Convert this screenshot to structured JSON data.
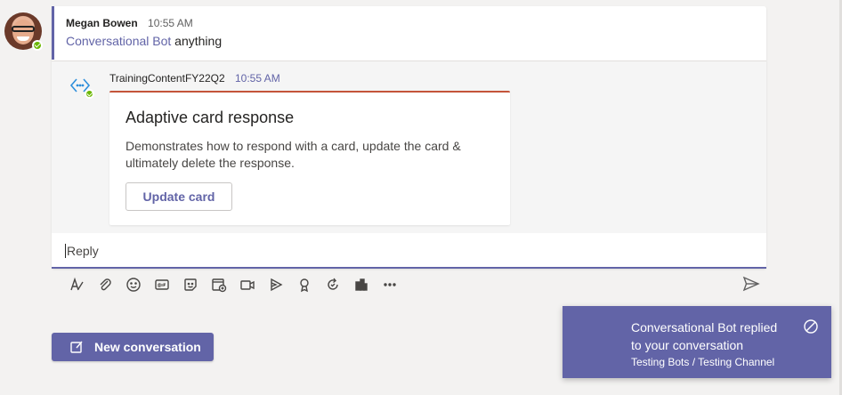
{
  "root_message": {
    "sender": "Megan Bowen",
    "time": "10:55 AM",
    "mention": "Conversational Bot",
    "text": " anything"
  },
  "bot_reply": {
    "sender": "TrainingContentFY22Q2",
    "time": "10:55 AM",
    "card": {
      "title": "Adaptive card response",
      "description": "Demonstrates how to respond with a card, update the card & ultimately delete the response.",
      "button_label": "Update card"
    }
  },
  "reply_box": {
    "placeholder": "Reply"
  },
  "toolbar": {
    "icons": [
      "format-icon",
      "attach-icon",
      "emoji-icon",
      "gif-icon",
      "sticker-icon",
      "schedule-meeting-icon",
      "meet-now-icon",
      "stream-icon",
      "praise-icon",
      "loop-icon",
      "apps-icon",
      "more-options-icon",
      "send-icon"
    ]
  },
  "new_conversation": {
    "label": "New conversation"
  },
  "toast": {
    "title": "Conversational Bot replied to your conversation",
    "subtitle": "Testing Bots / Testing Channel"
  },
  "colors": {
    "accent": "#6264a7",
    "card_top_border": "#c4543a",
    "presence": "#6bb700"
  }
}
